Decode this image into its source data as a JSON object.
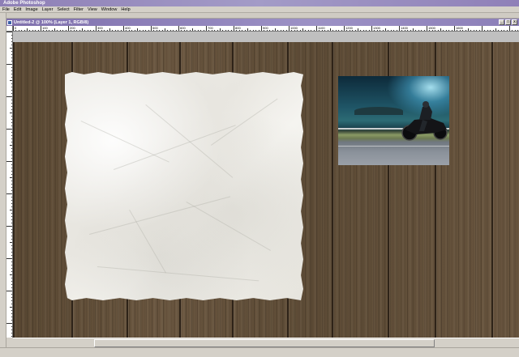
{
  "app": {
    "title": "Adobe Photoshop"
  },
  "menubar": {
    "items": [
      "File",
      "Edit",
      "Image",
      "Layer",
      "Select",
      "Filter",
      "View",
      "Window",
      "Help"
    ]
  },
  "document": {
    "title": "Untitled-2 @ 100% (Layer 1, RGB/8)"
  },
  "ruler": {
    "labels": [
      "0",
      "100",
      "200",
      "300",
      "400",
      "500",
      "600",
      "700",
      "800",
      "900",
      "1000",
      "1100",
      "1200",
      "1300",
      "1400",
      "1500",
      "1600"
    ]
  },
  "window_buttons": {
    "minimize": "_",
    "maximize": "□",
    "close": "x"
  },
  "colors": {
    "wood": "#5f4d37",
    "paper": "#f0efea",
    "titlebar": "#8c7fb8"
  },
  "icons": {
    "document": "photoshop-document-icon"
  }
}
